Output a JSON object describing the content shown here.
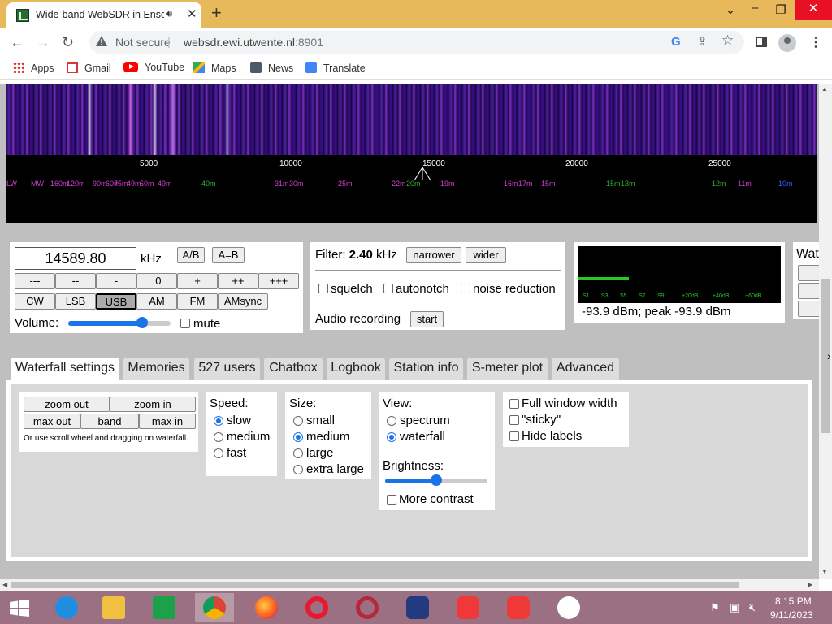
{
  "browser": {
    "tab_title": "Wide-band WebSDR in Enscl",
    "new_tab_symbol": "+",
    "security_label": "Not secure",
    "url_host": "websdr.ewi.utwente.nl",
    "url_port": ":8901",
    "bookmarks": [
      "Apps",
      "Gmail",
      "YouTube",
      "Maps",
      "News",
      "Translate"
    ]
  },
  "waterfall": {
    "freq_ticks": [
      "5000",
      "10000",
      "15000",
      "20000",
      "25000"
    ],
    "bands": [
      "LW",
      "MW",
      "160m",
      "120m",
      "90m",
      "60m",
      "75m",
      "49m",
      "60m",
      "49m",
      "40m",
      "31m",
      "30m",
      "25m",
      "22m",
      "20m",
      "19m",
      "16m",
      "17m",
      "15m",
      "15m",
      "13m",
      "12m",
      "11m",
      "10m"
    ]
  },
  "freq": {
    "value": "14589.80",
    "unit": "kHz",
    "ab": "A/B",
    "aeqb": "A=B",
    "step_buttons": [
      "---",
      "--",
      "-",
      ".0",
      "+",
      "++",
      "+++"
    ],
    "modes": [
      "CW",
      "LSB",
      "USB",
      "AM",
      "FM",
      "AMsync"
    ],
    "active_mode": "USB",
    "volume_label": "Volume:",
    "volume_level": 0.72,
    "mute_label": "mute"
  },
  "filter": {
    "label": "Filter:",
    "value": "2.40",
    "unit": "kHz",
    "narrower": "narrower",
    "wider": "wider",
    "squelch": "squelch",
    "autonotch": "autonotch",
    "noise_reduction": "noise reduction",
    "audio_recording": "Audio recording",
    "start": "start"
  },
  "smeter": {
    "ticks": [
      "S1",
      "S3",
      "S5",
      "S7",
      "S9",
      "+20dB",
      "+40dB",
      "+60dB"
    ],
    "reading": "-93.9 dBm; peak  -93.9 dBm",
    "level": 0.25
  },
  "partial_panel": {
    "title": "Wat"
  },
  "tabs": [
    "Waterfall settings",
    "Memories",
    "527 users",
    "Chatbox",
    "Logbook",
    "Station info",
    "S-meter plot",
    "Advanced"
  ],
  "zoom": {
    "zoom_out": "zoom out",
    "zoom_in": "zoom in",
    "max_out": "max out",
    "band": "band",
    "max_in": "max in",
    "hint": "Or use scroll wheel and dragging on waterfall."
  },
  "speed": {
    "title": "Speed:",
    "options": [
      "slow",
      "medium",
      "fast"
    ],
    "selected": "slow"
  },
  "size": {
    "title": "Size:",
    "options": [
      "small",
      "medium",
      "large",
      "extra large"
    ],
    "selected": "medium"
  },
  "view": {
    "title": "View:",
    "options": [
      "spectrum",
      "waterfall"
    ],
    "selected": "waterfall",
    "brightness_label": "Brightness:",
    "brightness_level": 0.5,
    "more_contrast": "More contrast"
  },
  "display": {
    "full_width": "Full window width",
    "sticky": "\"sticky\"",
    "hide_labels": "Hide labels"
  },
  "taskbar": {
    "time": "8:15 PM",
    "date": "9/11/2023"
  },
  "colors": {
    "tabbar": "#e8b95a",
    "taskbar": "#9b7082",
    "accent": "#1a73e8",
    "band_magenta": "#d040d0",
    "band_green": "#30b030"
  }
}
